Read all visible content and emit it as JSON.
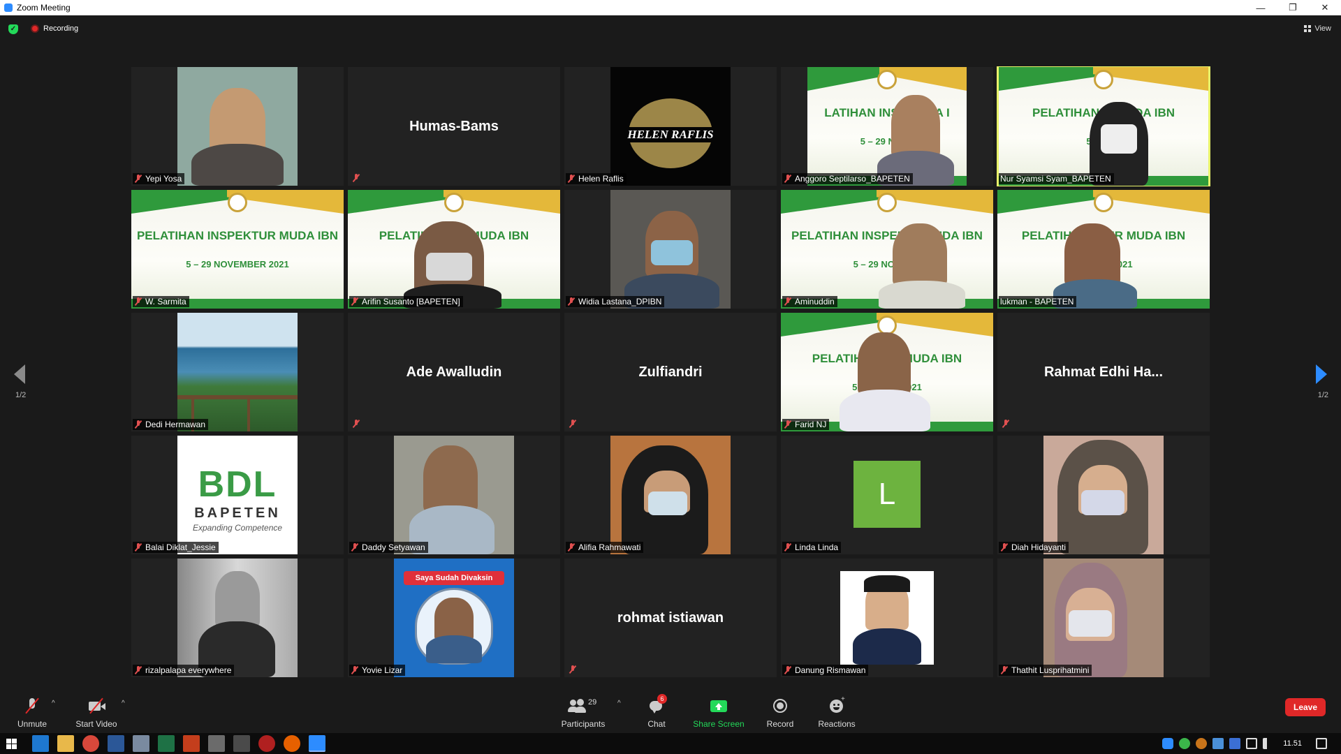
{
  "window": {
    "title": "Zoom Meeting",
    "minimize": "—",
    "restore": "❐",
    "close": "✕"
  },
  "status": {
    "recording": "Recording",
    "view": "View"
  },
  "gallery": {
    "page_left": "1/2",
    "page_right": "1/2",
    "tiles": [
      {
        "name": "Yepi Yosa",
        "big": ""
      },
      {
        "name": "",
        "big": "Humas-Bams"
      },
      {
        "name": "Helen Raflis",
        "big": "",
        "logo": "HELEN RAFLIS"
      },
      {
        "name": "Anggoro Septilarso_BAPETEN",
        "big": "",
        "banner": "LATIHAN INSPE    UDA I",
        "banner_date": "5 – 29 NOVE"
      },
      {
        "name": "Nur Syamsi Syam_BAPETEN",
        "big": "",
        "banner": "PELATIHAN INS        UDA IBN",
        "banner_date": "5 – 29 N"
      },
      {
        "name": "W. Sarmita",
        "big": "",
        "banner": "PELATIHAN INSPEKTUR MUDA IBN",
        "banner_date": "5 – 29 NOVEMBER 2021"
      },
      {
        "name": "Arifin Susanto [BAPETEN]",
        "big": "",
        "banner": "PELATIHAN           UR MUDA IBN",
        "banner_date": "5         2021"
      },
      {
        "name": "Widia Lastana_DPIBN",
        "big": ""
      },
      {
        "name": "Aminuddin",
        "big": "",
        "banner": "PELATIHAN INSPEKTUR      UDA IBN",
        "banner_date": "5 – 29 NOVEMB"
      },
      {
        "name": "lukman - BAPETEN",
        "big": "",
        "banner": "PELATIHAN I        TUR MUDA IBN",
        "banner_date": "5 – 2           ER 2021"
      },
      {
        "name": "Dedi Hermawan",
        "big": ""
      },
      {
        "name": "",
        "big": "Ade Awalludin"
      },
      {
        "name": "",
        "big": "Zulfiandri"
      },
      {
        "name": "Farid NJ",
        "big": "",
        "banner": "PELATIHAN            UR MUDA IBN",
        "banner_date": "5 – 29          BER 2021"
      },
      {
        "name": "",
        "big": "Rahmat Edhi Ha..."
      },
      {
        "name": "Balai Diklat_Jessie",
        "big": "",
        "bdl": "BDL",
        "bdl_sub": "BAPETEN",
        "bdl_tag": "Expanding Competence"
      },
      {
        "name": "Daddy Setyawan",
        "big": ""
      },
      {
        "name": "Alifia Rahmawati",
        "big": ""
      },
      {
        "name": "Linda Linda",
        "big": "",
        "initial": "L"
      },
      {
        "name": "Diah Hidayanti",
        "big": ""
      },
      {
        "name": "rizalpalapa everywhere",
        "big": ""
      },
      {
        "name": "Yovie Lizar",
        "big": "",
        "poster": "Saya Sudah Divaksin"
      },
      {
        "name": "",
        "big": "rohmat istiawan"
      },
      {
        "name": "Danung Rismawan",
        "big": ""
      },
      {
        "name": "Thathit Lusprihatmini",
        "big": ""
      }
    ]
  },
  "toolbar": {
    "unmute": "Unmute",
    "start_video": "Start Video",
    "participants": "Participants",
    "participants_count": "29",
    "chat": "Chat",
    "chat_badge": "6",
    "share_screen": "Share Screen",
    "record": "Record",
    "reactions": "Reactions",
    "leave": "Leave"
  },
  "taskbar": {
    "clock": "11.51"
  },
  "colors": {
    "accent": "#2d8cff",
    "leave": "#e02828",
    "share": "#23d959",
    "active_speaker": "#e8f26a",
    "banner_green": "#2f9a3c"
  }
}
